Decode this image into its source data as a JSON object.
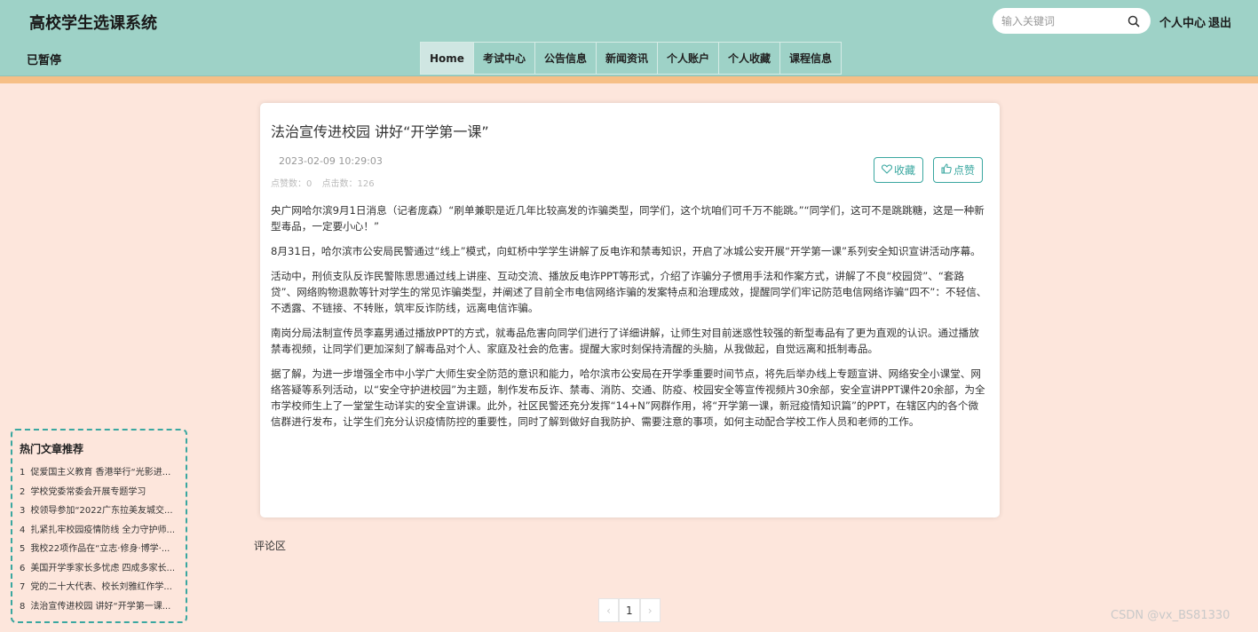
{
  "header": {
    "site_title": "高校学生选课系统",
    "user_label": "已暂停",
    "search_placeholder": "输入关键词",
    "links": {
      "personal_center": "个人中心",
      "logout": "退出"
    },
    "bg_color": "#9ed2c7",
    "stripe_color": "#f6bf86"
  },
  "nav": {
    "items": [
      {
        "label": "Home",
        "active": true
      },
      {
        "label": "考试中心"
      },
      {
        "label": "公告信息"
      },
      {
        "label": "新闻资讯"
      },
      {
        "label": "个人账户"
      },
      {
        "label": "个人收藏"
      },
      {
        "label": "课程信息"
      }
    ]
  },
  "article": {
    "title": "法治宣传进校园 讲好“开学第一课”",
    "date": "2023-02-09 10:29:03",
    "likes_label": "点赞数：0",
    "clicks_label": "点击数：126",
    "favorite_label": "收藏",
    "like_label": "点赞",
    "paragraphs": [
      "央广网哈尔滨9月1日消息（记者庞森）“刷单兼职是近几年比较高发的诈骗类型，同学们，这个坑咱们可千万不能跳。”“同学们，这可不是跳跳糖，这是一种新型毒品，一定要小心！”",
      "8月31日，哈尔滨市公安局民警通过“线上”模式，向虹桥中学学生讲解了反电诈和禁毒知识，开启了冰城公安开展“开学第一课”系列安全知识宣讲活动序幕。",
      "活动中，刑侦支队反诈民警陈思思通过线上讲座、互动交流、播放反电诈PPT等形式，介绍了诈骗分子惯用手法和作案方式，讲解了不良“校园贷”、“套路贷”、网络购物退款等针对学生的常见诈骗类型，并阐述了目前全市电信网络诈骗的发案特点和治理成效，提醒同学们牢记防范电信网络诈骗“四不”：不轻信、不透露、不链接、不转账，筑牢反诈防线，远离电信诈骗。",
      "南岗分局法制宣传员李嘉男通过播放PPT的方式，就毒品危害向同学们进行了详细讲解，让师生对目前迷惑性较强的新型毒品有了更为直观的认识。通过播放禁毒视频，让同学们更加深刻了解毒品对个人、家庭及社会的危害。提醒大家时刻保持清醒的头脑，从我做起，自觉远离和抵制毒品。",
      "据了解，为进一步增强全市中小学广大师生安全防范的意识和能力，哈尔滨市公安局在开学季重要时间节点，将先后举办线上专题宣讲、网络安全小课堂、网络答疑等系列活动，以“安全守护进校园”为主题，制作发布反诈、禁毒、消防、交通、防疫、校园安全等宣传视频片30余部，安全宣讲PPT课件20余部，为全市学校师生上了一堂堂生动详实的安全宣讲课。此外，社区民警还充分发挥“14+N”网群作用，将“开学第一课，新冠疫情知识篇”的PPT，在辖区内的各个微信群进行发布，让学生们充分认识疫情防控的重要性，同时了解到做好自我防护、需要注意的事项，如何主动配合学校工作人员和老师的工作。"
    ]
  },
  "comments": {
    "label": "评论区"
  },
  "pagination": {
    "prev": "‹",
    "current": "1",
    "next": "›"
  },
  "hot": {
    "title": "热门文章推荐",
    "items": [
      {
        "num": "1",
        "text": "促爱国主义教育 香港举行“光影进..."
      },
      {
        "num": "2",
        "text": "学校党委常委会开展专题学习"
      },
      {
        "num": "3",
        "text": "校领导参加“2022广东拉美友城交..."
      },
      {
        "num": "4",
        "text": "扎紧扎牢校园疫情防线 全力守护师..."
      },
      {
        "num": "5",
        "text": "我校22项作品在“立志·修身·博学·..."
      },
      {
        "num": "6",
        "text": "美国开学季家长多忧虑 四成多家长..."
      },
      {
        "num": "7",
        "text": "党的二十大代表、校长刘雅红作学..."
      },
      {
        "num": "8",
        "text": "法治宣传进校园 讲好“开学第一课..."
      }
    ]
  },
  "watermark": "CSDN @vx_BS81330",
  "accent_color": "#3aa7a0"
}
